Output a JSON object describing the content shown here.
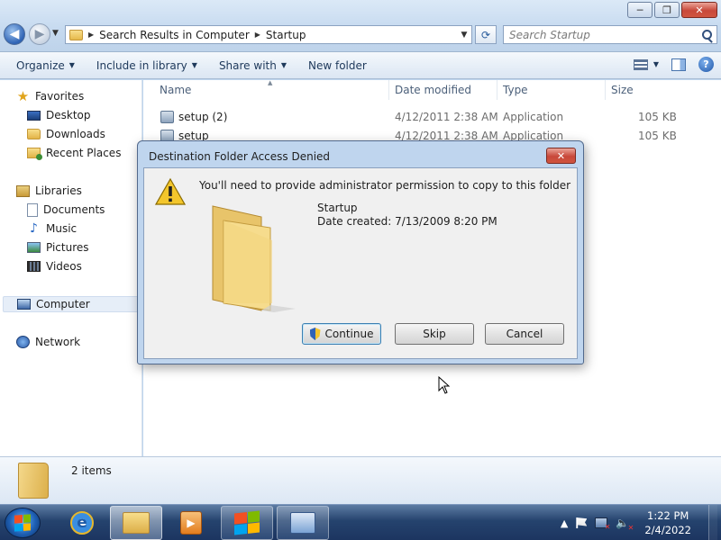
{
  "window": {
    "controls": {
      "minimize": "─",
      "maximize": "❐",
      "close": "✕"
    }
  },
  "address": {
    "crumbs": [
      "Search Results in Computer",
      "Startup"
    ],
    "search_placeholder": "Search Startup"
  },
  "toolbar": {
    "organize": "Organize",
    "include_in_library": "Include in library",
    "share_with": "Share with",
    "new_folder": "New folder",
    "help": "?"
  },
  "sidebar": {
    "favorites": "Favorites",
    "desktop": "Desktop",
    "downloads": "Downloads",
    "recent_places": "Recent Places",
    "libraries": "Libraries",
    "documents": "Documents",
    "music": "Music",
    "pictures": "Pictures",
    "videos": "Videos",
    "computer": "Computer",
    "network": "Network"
  },
  "columns": {
    "name": "Name",
    "date_modified": "Date modified",
    "type": "Type",
    "size": "Size"
  },
  "files": [
    {
      "name": "setup (2)",
      "date": "4/12/2011 2:38 AM",
      "type": "Application",
      "size": "105 KB"
    },
    {
      "name": "setup",
      "date": "4/12/2011 2:38 AM",
      "type": "Application",
      "size": "105 KB"
    }
  ],
  "details": {
    "item_count": "2 items"
  },
  "dialog": {
    "title": "Destination Folder Access Denied",
    "close": "✕",
    "message": "You'll need to provide administrator permission to copy to this folder",
    "folder_name": "Startup",
    "date_created": "Date created: 7/13/2009 8:20 PM",
    "continue": "Continue",
    "skip": "Skip",
    "cancel": "Cancel"
  },
  "taskbar": {
    "ie_glyph": "e",
    "time": "1:22 PM",
    "date": "2/4/2022"
  },
  "colors": {
    "accent": "#1e395b",
    "dialog_frame": "#bfd5ee",
    "taskbar": "#25436e"
  }
}
